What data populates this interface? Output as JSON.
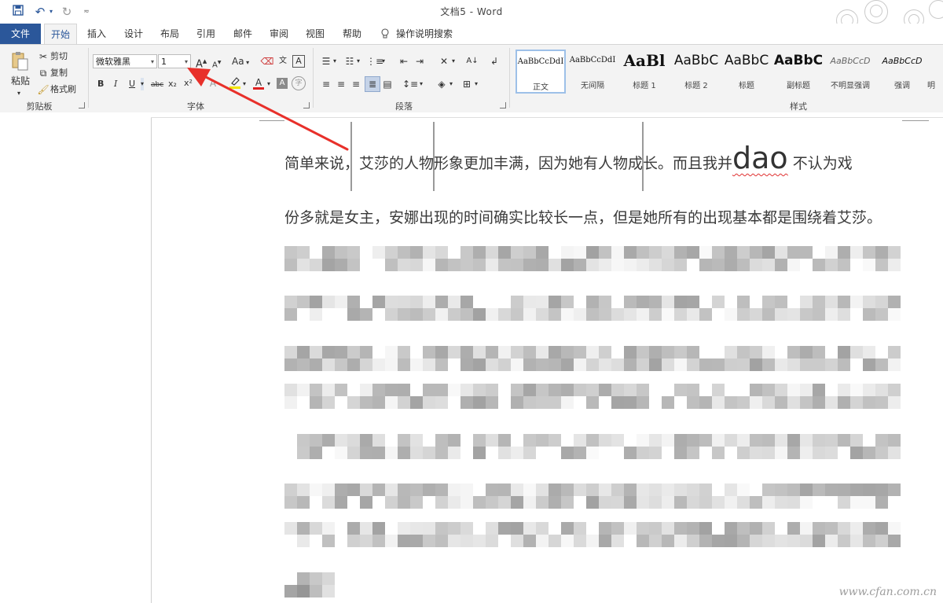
{
  "window": {
    "title": "文档5  -  Word"
  },
  "quick_access": {
    "save_icon": "save-icon",
    "undo_icon": "undo-icon",
    "redo_icon": "redo-icon",
    "customize_icon": "customize-icon"
  },
  "tabs": [
    {
      "label": "文件",
      "id": "file"
    },
    {
      "label": "开始",
      "id": "home",
      "active": true
    },
    {
      "label": "插入",
      "id": "insert"
    },
    {
      "label": "设计",
      "id": "design"
    },
    {
      "label": "布局",
      "id": "layout"
    },
    {
      "label": "引用",
      "id": "references"
    },
    {
      "label": "邮件",
      "id": "mailings"
    },
    {
      "label": "审阅",
      "id": "review"
    },
    {
      "label": "视图",
      "id": "view"
    },
    {
      "label": "帮助",
      "id": "help"
    },
    {
      "label": "操作说明搜索",
      "id": "tell-me"
    }
  ],
  "clipboard": {
    "group_label": "剪贴板",
    "paste": "粘贴",
    "cut": "剪切",
    "copy": "复制",
    "format_painter": "格式刷"
  },
  "font": {
    "group_label": "字体",
    "font_name": "微软雅黑",
    "font_size": "1",
    "grow_icon": "A",
    "shrink_icon": "A",
    "case_label": "Aa",
    "bold": "B",
    "italic": "I",
    "underline": "U",
    "strike": "abc",
    "subscript": "x₂",
    "superscript": "x²",
    "font_color_letter": "A",
    "highlight_color": "#f2e600",
    "font_color": "#e02020"
  },
  "paragraph": {
    "group_label": "段落"
  },
  "styles": {
    "group_label": "样式",
    "items": [
      {
        "sample": "AaBbCcDdI",
        "name": "正文",
        "selected": true
      },
      {
        "sample": "AaBbCcDdI",
        "name": "无间隔"
      },
      {
        "sample": "AaBl",
        "name": "标题 1"
      },
      {
        "sample": "AaBbC",
        "name": "标题 2"
      },
      {
        "sample": "AaBbC",
        "name": "标题"
      },
      {
        "sample": "AaBbC",
        "name": "副标题"
      },
      {
        "sample": "AaBbCcD",
        "name": "不明显强调"
      },
      {
        "sample": "AaBbCcD",
        "name": "强调"
      },
      {
        "sample": "",
        "name": "明"
      }
    ]
  },
  "document": {
    "line1_a": "简单来说，艾莎的人物形象更加丰满，因为她有人物成长。而且我并",
    "line1_big": "dao",
    "line1_b": " 不认为戏",
    "line2": "份多就是女主，安娜出现的时间确实比较长一点，但是她所有的出现基本都是围绕着艾莎。"
  },
  "watermark": "www.cfan.com.cn",
  "annotation": {
    "arrow_color": "#e8302a"
  }
}
